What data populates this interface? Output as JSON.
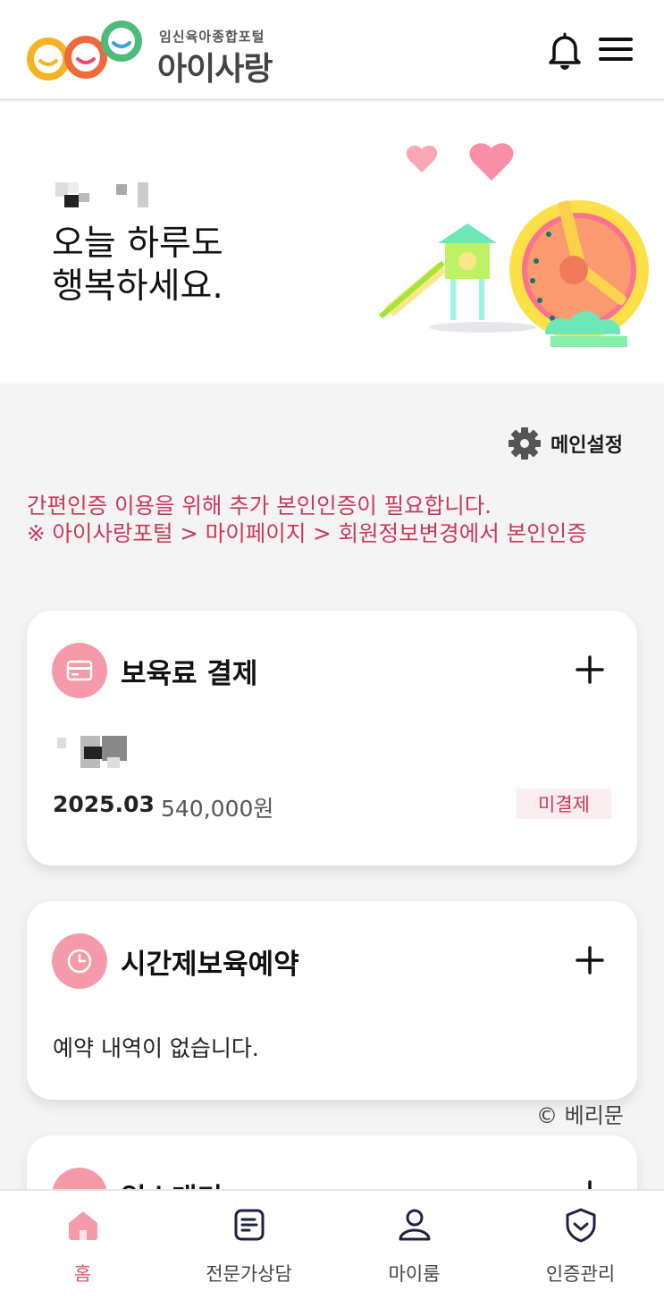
{
  "header": {
    "logo_subtitle": "임신육아종합포털",
    "logo_title": "아이사랑",
    "icons": [
      "bell-icon",
      "hamburger-menu-icon"
    ]
  },
  "hero": {
    "greeting": "오늘 하루도\n행복하세요."
  },
  "settings": {
    "label": "메인설정",
    "icon": "gear-icon"
  },
  "notice": {
    "text": "간편인증 이용을 위해 추가 본인인증이 필요합니다.\n※ 아이사랑포털 > 마이페이지 > 회원정보변경에서 본인인증"
  },
  "cards": {
    "payment": {
      "title": "보육료 결제",
      "icon": "card-icon",
      "date": "2025.03",
      "amount": "540,000원",
      "status": "미결제"
    },
    "reservation": {
      "title": "시간제보육예약",
      "icon": "clock-icon",
      "empty_text": "예약 내역이 없습니다."
    },
    "third": {
      "title": "입소대기",
      "icon": "child-icon"
    }
  },
  "watermark": "© 베리문",
  "bottom_nav": {
    "items": [
      {
        "label": "홈",
        "icon": "home-icon",
        "active": true
      },
      {
        "label": "전문가상담",
        "icon": "document-icon",
        "active": false
      },
      {
        "label": "마이룸",
        "icon": "person-icon",
        "active": false
      },
      {
        "label": "인증관리",
        "icon": "shield-icon",
        "active": false
      }
    ]
  },
  "colors": {
    "accent_pink": "#f59aa8",
    "notice_red": "#c83a5a",
    "nav_active": "#e2596d"
  }
}
